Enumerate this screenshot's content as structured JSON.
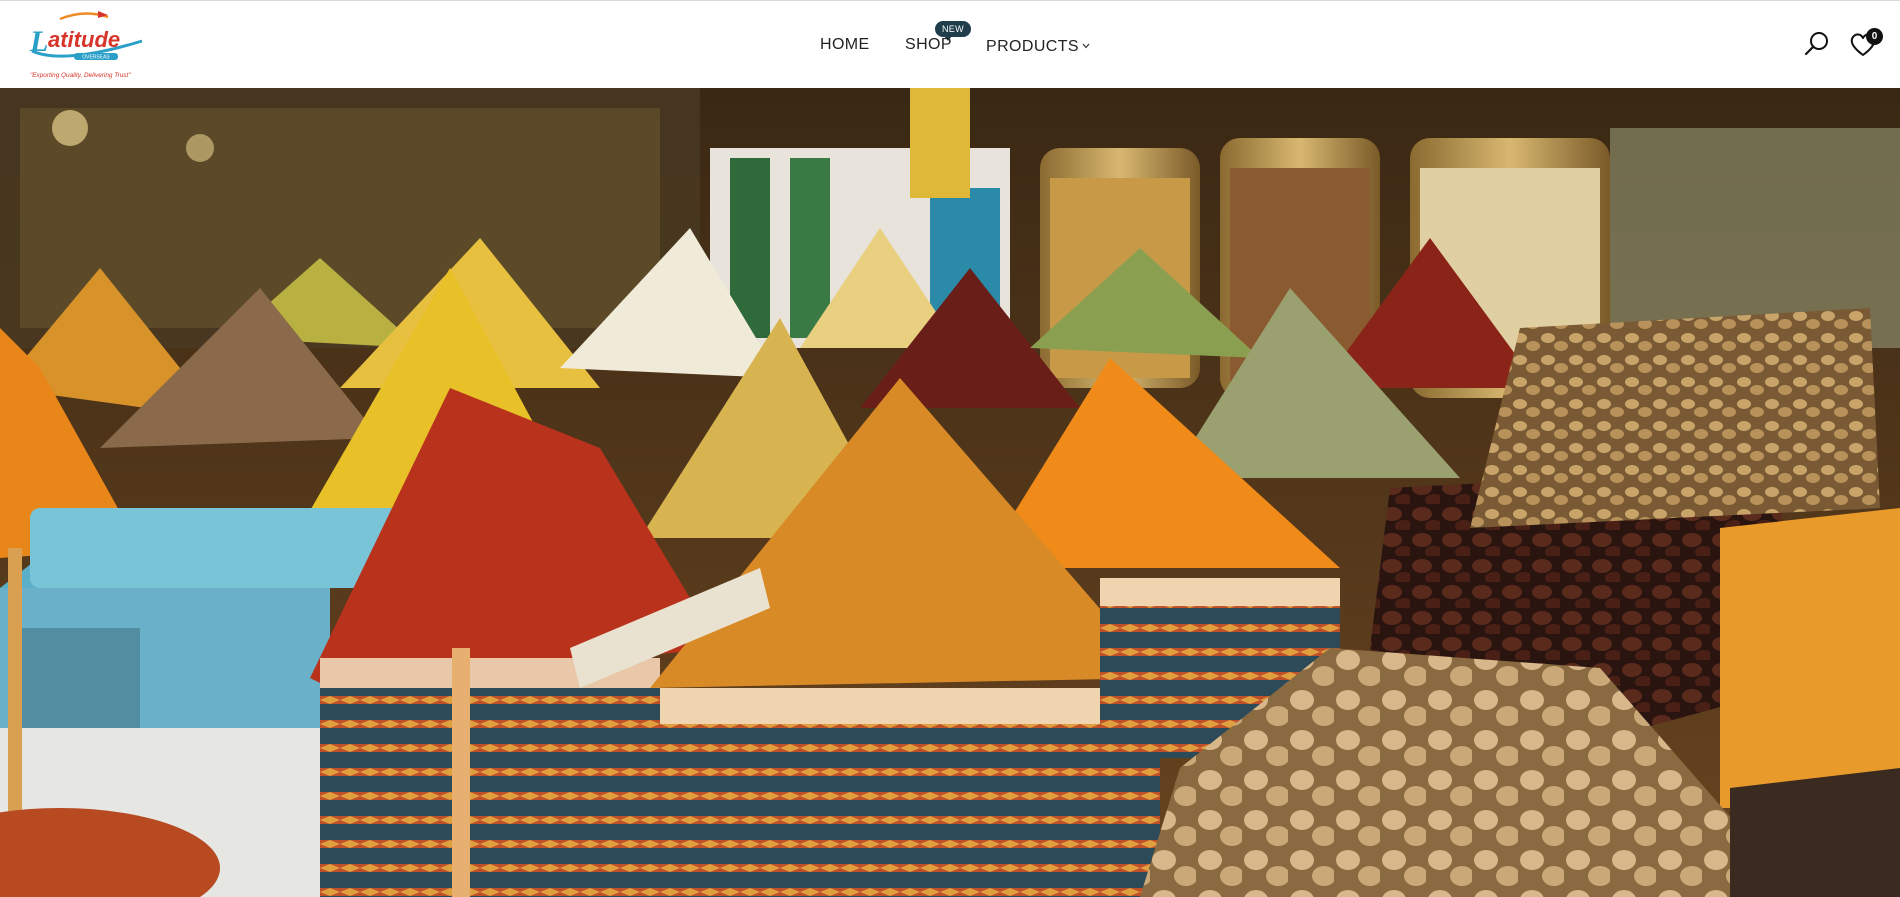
{
  "brand": {
    "logo_text": "Latitude",
    "logo_sub": "OVERSEAS",
    "tagline": "\"Exporting Quality, Delivering Trust\""
  },
  "nav": {
    "home": "HOME",
    "shop": "SHOP",
    "shop_badge": "NEW",
    "products": "PRODUCTS",
    "products_chevron": "chevron-down-icon"
  },
  "header_actions": {
    "search_icon": "search-icon",
    "wishlist_icon": "heart-icon",
    "wishlist_count": "0"
  },
  "hero": {
    "image_subject": "spice market"
  },
  "colors": {
    "badge": "#1f3d4a",
    "logo_blue": "#2aa0c8",
    "logo_orange": "#f08a24",
    "logo_red": "#d8352a"
  }
}
